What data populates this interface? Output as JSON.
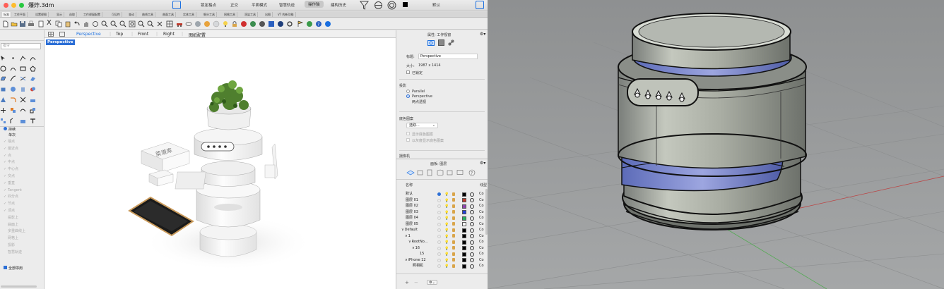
{
  "window": {
    "title": "爆炸.3dm",
    "toolbar_tabs": [
      "锁定格点",
      "正交",
      "平面模式",
      "智慧轨迹",
      "操作轴",
      "建构历史"
    ],
    "active_toolbar_tab": "操作轴",
    "display_mode": "默认"
  },
  "tab_strip": [
    "标准",
    "工作平面",
    "设置视图",
    "显示",
    "选取",
    "工作视窗配置",
    "可见性",
    "变动",
    "曲线工具",
    "曲面工具",
    "实体工具",
    "细分工具",
    "网格工具",
    "渲染工具",
    "出图",
    "V7 的新功能"
  ],
  "command": {
    "placeholder": "指令"
  },
  "snaps": {
    "header": [
      "持续",
      "单次"
    ],
    "items": [
      "端点",
      "最近点",
      "点",
      "中点",
      "中心点",
      "交点",
      "垂直",
      "Tangent",
      "四分点",
      "节点",
      "顶点",
      "投影上",
      "曲面上",
      "多重曲线上",
      "网格上",
      "投影",
      "智慧轨迹"
    ],
    "disable_all": "全部停用"
  },
  "viewport": {
    "tabs": [
      "Perspective",
      "Top",
      "Front",
      "Right",
      "图纸配置"
    ],
    "active_label": "Perspective",
    "box_text": "菜谱库"
  },
  "properties": {
    "header": "属性: 工作视窗",
    "title_label": "标题:",
    "title_value": "Perspective",
    "size_label": "大小:",
    "size_value": "1987 x 1414",
    "locked_label": "已锁定",
    "projection_header": "投影",
    "projection_options": [
      "Parallel",
      "Perspective",
      "两点透视"
    ],
    "projection_selected": "Perspective",
    "bg_header": "底色图案",
    "bg_select": "选取...",
    "bg_opt1": "显示底色图案",
    "bg_opt2": "以灰度显示底色图案",
    "camera_header": "摄像机"
  },
  "layers": {
    "header": "面板: 图层",
    "col_name": "名称",
    "col_extra": "线型",
    "rows": [
      {
        "name": "默认",
        "indent": 0,
        "color": "#000000",
        "current": true,
        "mat": "Co"
      },
      {
        "name": "图层 01",
        "indent": 0,
        "color": "#c0392b",
        "mat": "Co"
      },
      {
        "name": "图层 02",
        "indent": 0,
        "color": "#8e44ad",
        "mat": "Co"
      },
      {
        "name": "图层 03",
        "indent": 0,
        "color": "#2541d8",
        "mat": "Co"
      },
      {
        "name": "图层 04",
        "indent": 0,
        "color": "#27ae60",
        "mat": "Co"
      },
      {
        "name": "图层 05",
        "indent": 0,
        "color": "#ffffff",
        "mat": "Co"
      },
      {
        "name": "Default",
        "indent": 0,
        "color": "#000000",
        "expand": "∨",
        "mat": "Co"
      },
      {
        "name": "1",
        "indent": 1,
        "color": "#000000",
        "expand": "∨",
        "mat": "Co"
      },
      {
        "name": "RootNo...",
        "indent": 2,
        "color": "#000000",
        "expand": "∨",
        "mat": "Co"
      },
      {
        "name": "16",
        "indent": 3,
        "color": "#000000",
        "expand": "∨",
        "mat": "Co"
      },
      {
        "name": "15",
        "indent": 4,
        "color": "#000000",
        "mat": "Co"
      },
      {
        "name": "iPhone 12",
        "indent": 1,
        "color": "#000000",
        "expand": "∨",
        "mat": "Co"
      },
      {
        "name": "照相机",
        "indent": 2,
        "color": "#000000",
        "mat": "Co"
      }
    ]
  }
}
